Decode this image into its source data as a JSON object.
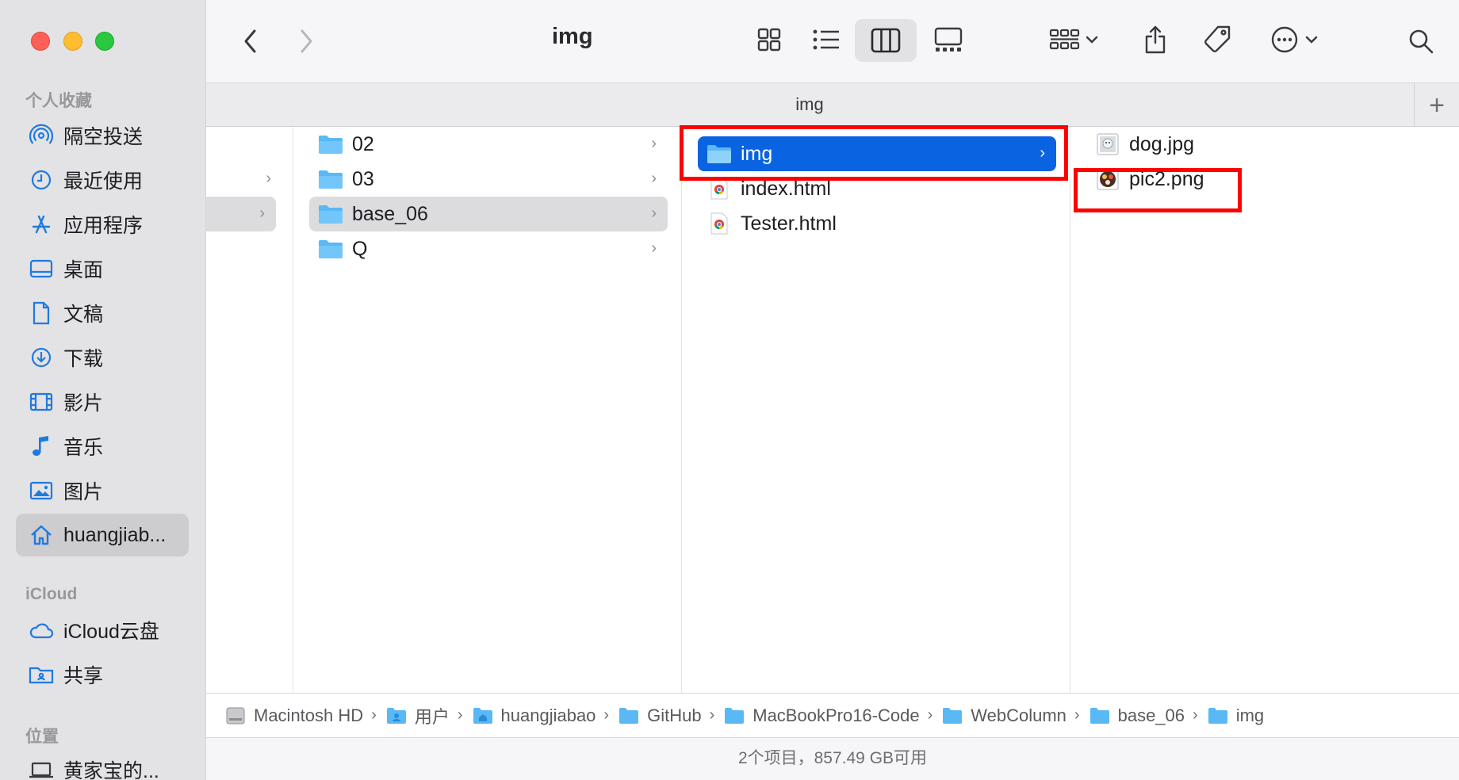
{
  "window": {
    "title": "img"
  },
  "sidebar": {
    "sections": [
      {
        "title": "个人收藏",
        "items": [
          {
            "label": "隔空投送",
            "icon": "airdrop-icon"
          },
          {
            "label": "最近使用",
            "icon": "clock-icon"
          },
          {
            "label": "应用程序",
            "icon": "applications-icon"
          },
          {
            "label": "桌面",
            "icon": "desktop-icon"
          },
          {
            "label": "文稿",
            "icon": "document-icon"
          },
          {
            "label": "下载",
            "icon": "download-icon"
          },
          {
            "label": "影片",
            "icon": "movies-icon"
          },
          {
            "label": "音乐",
            "icon": "music-icon"
          },
          {
            "label": "图片",
            "icon": "pictures-icon"
          },
          {
            "label": "huangjiab...",
            "icon": "home-icon",
            "selected": true
          }
        ]
      },
      {
        "title": "iCloud",
        "items": [
          {
            "label": "iCloud云盘",
            "icon": "cloud-icon"
          },
          {
            "label": "共享",
            "icon": "shared-folder-icon"
          }
        ]
      },
      {
        "title": "位置",
        "items": [
          {
            "label": "黄家宝的...",
            "icon": "laptop-icon"
          }
        ]
      }
    ]
  },
  "toolbar": {
    "title": "img"
  },
  "tabbar": {
    "title": "img",
    "add_label": "+"
  },
  "columns": {
    "col1": {
      "items": []
    },
    "col2": {
      "items": [
        {
          "name": "02",
          "type": "folder"
        },
        {
          "name": "03",
          "type": "folder"
        },
        {
          "name": "base_06",
          "type": "folder",
          "selected": true
        },
        {
          "name": "Q",
          "type": "folder"
        }
      ]
    },
    "col3": {
      "items": [
        {
          "name": "img",
          "type": "folder",
          "selected": true
        },
        {
          "name": "index.html",
          "type": "html"
        },
        {
          "name": "Tester.html",
          "type": "html"
        }
      ]
    },
    "col4": {
      "items": [
        {
          "name": "dog.jpg",
          "type": "image"
        },
        {
          "name": "pic2.png",
          "type": "image"
        }
      ]
    }
  },
  "pathbar": {
    "crumbs": [
      {
        "label": "Macintosh HD",
        "icon": "hard-drive-icon"
      },
      {
        "label": "用户",
        "icon": "users-folder-icon"
      },
      {
        "label": "huangjiabao",
        "icon": "home-folder-icon"
      },
      {
        "label": "GitHub",
        "icon": "folder-icon"
      },
      {
        "label": "MacBookPro16-Code",
        "icon": "folder-icon"
      },
      {
        "label": "WebColumn",
        "icon": "folder-icon"
      },
      {
        "label": "base_06",
        "icon": "folder-icon"
      },
      {
        "label": "img",
        "icon": "folder-icon"
      }
    ]
  },
  "status": {
    "text": "2个项目，857.49 GB可用"
  },
  "colors": {
    "accent": "#0a63e0",
    "highlight_box": "#ff0000",
    "folder": "#5ab8f5"
  }
}
